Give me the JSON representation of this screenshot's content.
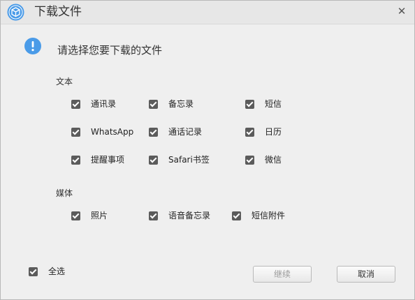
{
  "window": {
    "title": "下载文件",
    "close_glyph": "✕"
  },
  "icons": {
    "app": "cube-icon",
    "info": "info-icon",
    "accent": "#4a9be8"
  },
  "prompt": "请选择您要下载的文件",
  "sections": {
    "text": {
      "label": "文本",
      "items": [
        {
          "label": "通讯录",
          "checked": true
        },
        {
          "label": "备忘录",
          "checked": true
        },
        {
          "label": "短信",
          "checked": true
        },
        {
          "label": "WhatsApp",
          "checked": true
        },
        {
          "label": "通话记录",
          "checked": true
        },
        {
          "label": "日历",
          "checked": true
        },
        {
          "label": "提醒事项",
          "checked": true
        },
        {
          "label": "Safari书签",
          "checked": true
        },
        {
          "label": "微信",
          "checked": true
        }
      ]
    },
    "media": {
      "label": "媒体",
      "items": [
        {
          "label": "照片",
          "checked": true
        },
        {
          "label": "语音备忘录",
          "checked": true
        },
        {
          "label": "短信附件",
          "checked": true
        }
      ]
    }
  },
  "select_all": {
    "label": "全选",
    "checked": true
  },
  "buttons": {
    "continue": "继续",
    "cancel": "取消"
  }
}
